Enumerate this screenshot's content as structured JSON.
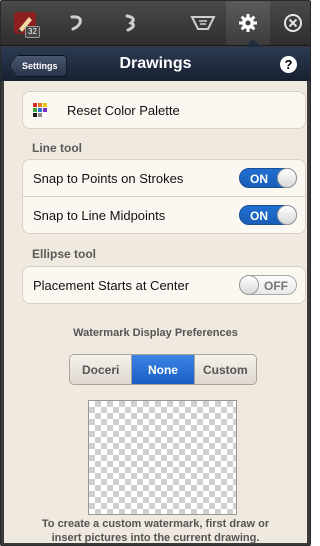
{
  "toolbar": {
    "page_number": "32",
    "icons": [
      "pencil-icon",
      "undo-icon",
      "redo-icon",
      "clear-screen-icon",
      "gear-icon",
      "close-icon"
    ]
  },
  "header": {
    "back_label": "Settings",
    "title": "Drawings",
    "help_label": "?"
  },
  "palette_row": {
    "label": "Reset Color Palette",
    "swatch_colors": [
      "#d62b2b",
      "#e07b1a",
      "#e8c318",
      "#3da33a",
      "#2a6fd1",
      "#7b2fc6",
      "#1c1c1c",
      "#8a8a8a",
      "#ffffff"
    ]
  },
  "line_tool": {
    "section_label": "Line tool",
    "rows": [
      {
        "label": "Snap to Points on Strokes",
        "toggle": "ON"
      },
      {
        "label": "Snap to Line Midpoints",
        "toggle": "ON"
      }
    ]
  },
  "ellipse_tool": {
    "section_label": "Ellipse tool",
    "rows": [
      {
        "label": "Placement Starts at Center",
        "toggle": "OFF"
      }
    ]
  },
  "watermark": {
    "title": "Watermark Display Preferences",
    "options": [
      "Doceri",
      "None",
      "Custom"
    ],
    "selected": "None",
    "caption_line1": "To create a custom watermark, first draw or",
    "caption_line2": "insert pictures into the current drawing."
  },
  "colors": {
    "toggle_on": "#1f6fd1",
    "segment_selected": "#1a5fc4",
    "header_bg": "#1f2b3d",
    "content_bg": "#efe9df"
  }
}
